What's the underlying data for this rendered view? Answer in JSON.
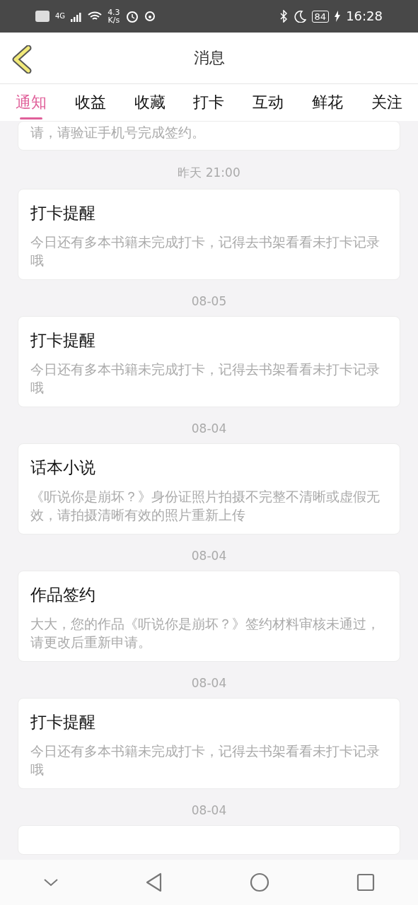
{
  "status_bar": {
    "network": "4G",
    "speed": "4.3",
    "speed_unit": "K/s",
    "battery": "84",
    "time": "16:28"
  },
  "header": {
    "title": "消息"
  },
  "tabs": [
    {
      "label": "通知",
      "selected": true
    },
    {
      "label": "收益",
      "selected": false
    },
    {
      "label": "收藏",
      "selected": false
    },
    {
      "label": "打卡",
      "selected": false
    },
    {
      "label": "互动",
      "selected": false
    },
    {
      "label": "鲜花",
      "selected": false
    },
    {
      "label": "关注",
      "selected": false
    }
  ],
  "messages": [
    {
      "kind": "partial",
      "body": "请，请验证手机号完成签约。"
    },
    {
      "kind": "full",
      "time": "昨天 21:00",
      "title": "打卡提醒",
      "body": "今日还有多本书籍未完成打卡，记得去书架看看未打卡记录哦"
    },
    {
      "kind": "full",
      "time": "08-05",
      "title": "打卡提醒",
      "body": "今日还有多本书籍未完成打卡，记得去书架看看未打卡记录哦"
    },
    {
      "kind": "full",
      "time": "08-04",
      "title": "话本小说",
      "body": "《听说你是崩坏？》身份证照片拍摄不完整不清晰或虚假无效，请拍摄清晰有效的照片重新上传"
    },
    {
      "kind": "full",
      "time": "08-04",
      "title": "作品签约",
      "body": "大大，您的作品《听说你是崩坏？》签约材料审核未通过，请更改后重新申请。"
    },
    {
      "kind": "full",
      "time": "08-04",
      "title": "打卡提醒",
      "body": "今日还有多本书籍未完成打卡，记得去书架看看未打卡记录哦"
    },
    {
      "kind": "cut",
      "time": "08-04"
    }
  ]
}
